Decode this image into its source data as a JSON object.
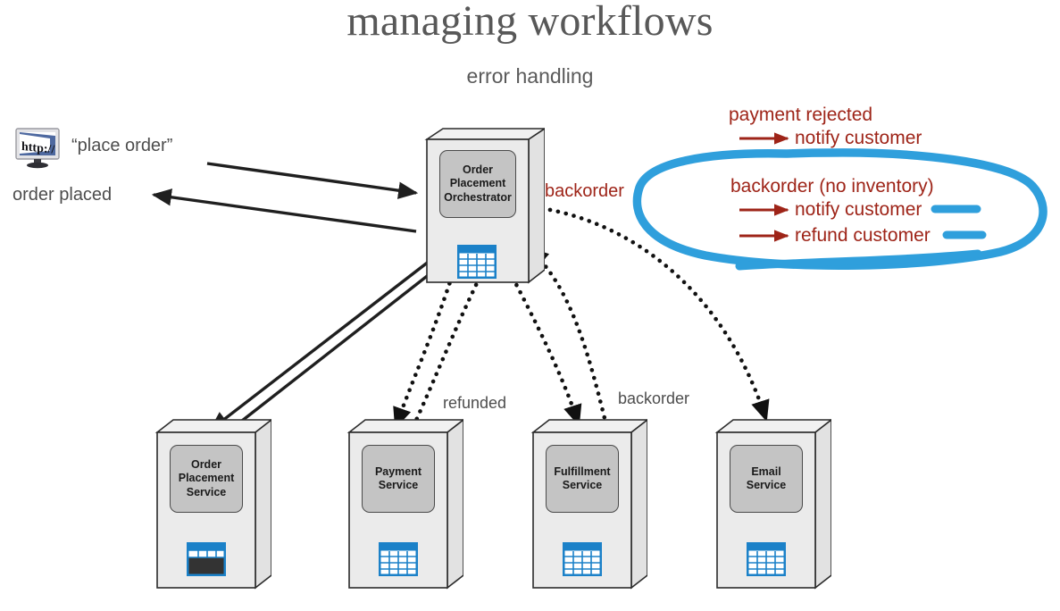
{
  "slide": {
    "title": "managing workflows",
    "subtitle": "error handling"
  },
  "colors": {
    "annotation_red": "#9e2418",
    "ink_blue": "#2f9fdc",
    "box_fill": "#ebebeb",
    "inner_fill": "#c4c4c4",
    "db_blue": "#1b81c8",
    "text_gray": "#4d4d4d"
  },
  "client": {
    "icon": "http-monitor-icon",
    "request_label": "“place order”",
    "response_label": "order placed"
  },
  "orchestrator": {
    "name": "Order\nPlacement\nOrchestrator",
    "line1": "Order",
    "line2": "Placement",
    "line3": "Orchestrator",
    "db_icon": "database-table-icon"
  },
  "services": [
    {
      "id": "order-placement-service",
      "line1": "Order",
      "line2": "Placement",
      "line3": "Service",
      "db_icon": "database-table-icon-dark"
    },
    {
      "id": "payment-service",
      "line1": "Payment",
      "line2": "Service",
      "line3": "",
      "db_icon": "database-table-icon"
    },
    {
      "id": "fulfillment-service",
      "line1": "Fulfillment",
      "line2": "Service",
      "line3": "",
      "db_icon": "database-table-icon"
    },
    {
      "id": "email-service",
      "line1": "Email",
      "line2": "Service",
      "line3": "",
      "db_icon": "database-table-icon"
    }
  ],
  "edge_labels": {
    "backorder_top": "backorder",
    "refunded": "refunded",
    "backorder_bottom": "backorder"
  },
  "annotations": {
    "rule1_condition": "payment rejected",
    "rule1_action": "notify customer",
    "rule2_condition": "backorder (no inventory)",
    "rule2_action1": "notify customer",
    "rule2_action2": "refund customer",
    "ink_shape": "hand-drawn-blue-ellipse",
    "ink_underline_1": "blue-highlight-dash",
    "ink_underline_2": "blue-highlight-dash"
  }
}
